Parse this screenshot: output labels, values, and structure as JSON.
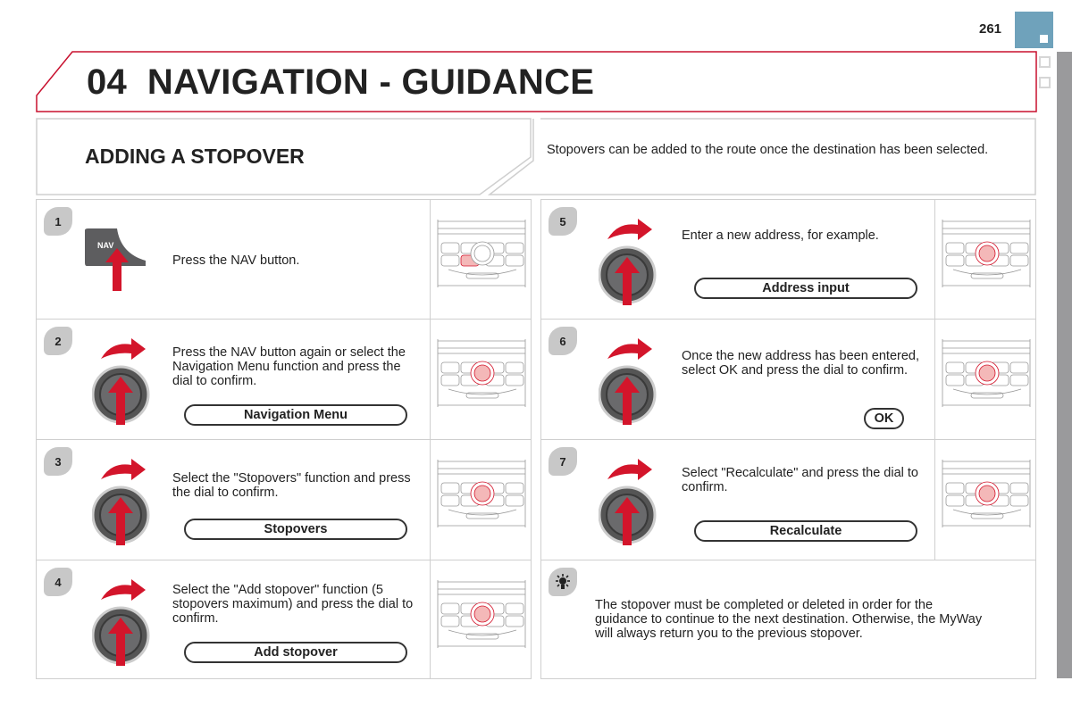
{
  "page_number": "261",
  "chapter": {
    "number": "04",
    "title": "NAVIGATION - GUIDANCE"
  },
  "section": {
    "title": "ADDING A STOPOVER",
    "intro": "Stopovers can be added to the route once the destination has been selected."
  },
  "colors": {
    "accent_red": "#c8102e",
    "tab_blue": "#6fa2bb",
    "badge_grey": "#c8c8c8",
    "side_bar": "#9a9a9c"
  },
  "steps": [
    {
      "number": "1",
      "icon": "nav-button-icon",
      "nav_label": "NAV",
      "text": "Press the NAV button.",
      "highlight": "nav"
    },
    {
      "number": "2",
      "icon": "dial-icon",
      "text": "Press the NAV button again or select the Navigation Menu function and press the dial to confirm.",
      "button": "Navigation Menu",
      "highlight": "dial"
    },
    {
      "number": "3",
      "icon": "dial-icon",
      "text": "Select the \"Stopovers\" function and press the dial to confirm.",
      "button": "Stopovers",
      "highlight": "dial"
    },
    {
      "number": "4",
      "icon": "dial-icon",
      "text": "Select the \"Add stopover\" function (5 stopovers maximum) and press the dial to confirm.",
      "button": "Add stopover",
      "highlight": "dial"
    },
    {
      "number": "5",
      "icon": "dial-icon",
      "text": "Enter a new address, for example.",
      "button": "Address input",
      "highlight": "dial"
    },
    {
      "number": "6",
      "icon": "dial-icon",
      "text": "Once the new address has been entered, select OK and press the dial to confirm.",
      "button": "OK",
      "button_small": true,
      "highlight": "dial"
    },
    {
      "number": "7",
      "icon": "dial-icon",
      "text": "Select \"Recalculate\" and press the dial to confirm.",
      "button": "Recalculate",
      "highlight": "dial"
    }
  ],
  "tip": {
    "icon": "lightbulb-icon",
    "text": "The stopover must be completed or deleted in order for the guidance to continue to the next destination. Otherwise, the MyWay will always return you to the previous stopover."
  }
}
